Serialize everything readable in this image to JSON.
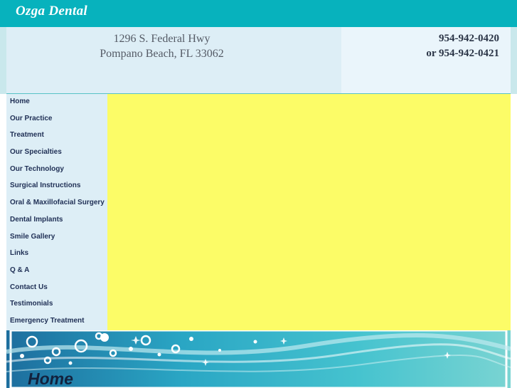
{
  "site": {
    "logo": "Ozga Dental"
  },
  "header": {
    "address_line1": "1296 S. Federal Hwy",
    "address_line2": "Pompano Beach, FL 33062",
    "phone1": "954-942-0420",
    "phone2": "or 954-942-0421"
  },
  "nav": {
    "items": [
      {
        "label": "Home"
      },
      {
        "label": "Our Practice"
      },
      {
        "label": "Treatment"
      },
      {
        "label": "Our Specialties"
      },
      {
        "label": "Our Technology"
      },
      {
        "label": "Surgical Instructions"
      },
      {
        "label": "Oral & Maxillofacial Surgery"
      },
      {
        "label": "Dental Implants"
      },
      {
        "label": "Smile Gallery"
      },
      {
        "label": "Links"
      },
      {
        "label": "Q & A"
      },
      {
        "label": "Contact Us"
      },
      {
        "label": "Testimonials"
      },
      {
        "label": "Emergency Treatment"
      }
    ]
  },
  "banner": {
    "title": "Home"
  },
  "colors": {
    "topbar": "#07b2bd",
    "header_bg": "#ddeef6",
    "content_bg": "#fcfc67",
    "nav_text": "#1f2f55"
  }
}
